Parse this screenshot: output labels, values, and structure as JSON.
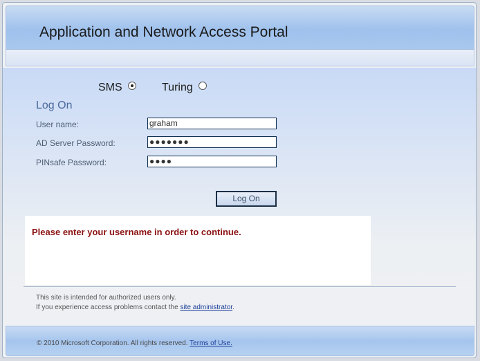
{
  "header": {
    "title": "Application and Network Access Portal"
  },
  "auth_mode": {
    "options": [
      {
        "label": "SMS",
        "selected": true
      },
      {
        "label": "Turing",
        "selected": false
      }
    ]
  },
  "form": {
    "heading": "Log On",
    "username_label": "User name:",
    "username_value": "graham",
    "ad_password_label": "AD Server Password:",
    "ad_password_mask": "●●●●●●●",
    "pinsafe_password_label": "PINsafe Password:",
    "pinsafe_password_mask": "●●●●",
    "submit_label": "Log On"
  },
  "message": {
    "text": "Please enter your username in order to continue."
  },
  "notice": {
    "line1": "This site is intended for authorized users only.",
    "line2_prefix": "If you experience access problems contact the ",
    "line2_link": "site administrator",
    "line2_suffix": "."
  },
  "footer": {
    "copyright": "© 2010 Microsoft Corporation. All rights reserved. ",
    "terms_link": "Terms of Use."
  },
  "colors": {
    "header_blue": "#9fc1ec",
    "error_red": "#8b1111",
    "link_blue": "#1b3e9a",
    "heading_blue": "#4a6a9a"
  }
}
